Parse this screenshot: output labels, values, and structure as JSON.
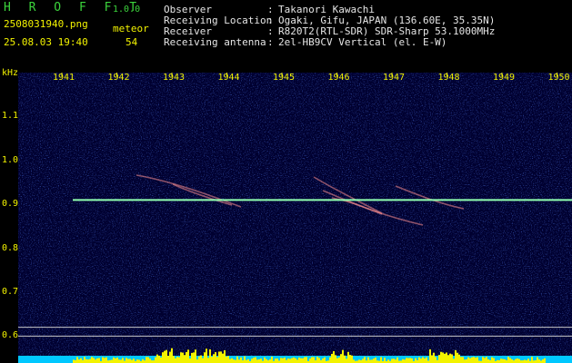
{
  "header": {
    "app_title": "H R O F F T",
    "version": "1.0.0",
    "filename": "2508031940.png",
    "timestamp": "25.08.03 19:40",
    "meteor_label": "meteor",
    "meteor_count": "54",
    "info": [
      {
        "label": "Observer",
        "sep": ":",
        "value": "Takanori Kawachi"
      },
      {
        "label": "Receiving Location",
        "sep": ":",
        "value": "Ogaki, Gifu, JAPAN (136.60E, 35.35N)"
      },
      {
        "label": "Receiver",
        "sep": ":",
        "value": "R820T2(RTL-SDR) SDR-Sharp 53.1000MHz"
      },
      {
        "label": "Receiving antenna",
        "sep": ":",
        "value": "2el-HB9CV Vertical (el. E-W)"
      }
    ]
  },
  "spectrogram": {
    "unit": "kHz",
    "time_ticks": [
      "1941",
      "1942",
      "1943",
      "1944",
      "1945",
      "1946",
      "1947",
      "1948",
      "1949",
      "1950"
    ],
    "freq_ticks": [
      "1.1",
      "1.0",
      "0.9",
      "0.8",
      "0.7",
      "0.6"
    ],
    "freq_tick_values": [
      1.1,
      1.0,
      0.9,
      0.8,
      0.7,
      0.6
    ],
    "freq_range": [
      0.58,
      1.2
    ],
    "carrier_freq": 0.91,
    "colors": {
      "background": "#000030",
      "carrier": "#90ffb0",
      "trails": "#ff9090",
      "activity": "#f3f300",
      "baseline": "#00c8ff"
    }
  }
}
